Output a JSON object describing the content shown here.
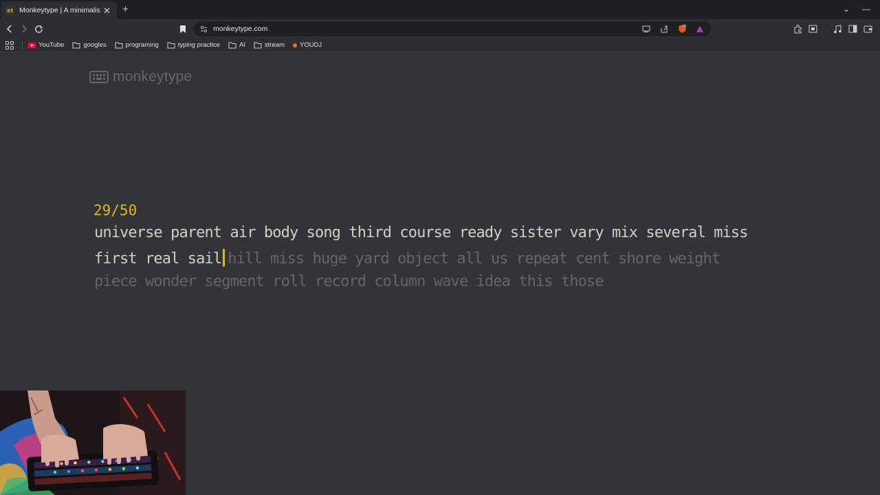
{
  "browser": {
    "tab": {
      "title": "Monkeytype | A minimalistic, customizable typing test",
      "favicon_text": "mt"
    },
    "url": "monkeytype.com",
    "bookmarks": [
      {
        "label": "YouTube",
        "icon": "youtube-icon"
      },
      {
        "label": "googles",
        "icon": "folder-icon"
      },
      {
        "label": "programing",
        "icon": "folder-icon"
      },
      {
        "label": "typing practice",
        "icon": "folder-icon"
      },
      {
        "label": "AI",
        "icon": "folder-icon"
      },
      {
        "label": "stream",
        "icon": "folder-icon"
      },
      {
        "label": "YOUDJ",
        "icon": "site-dot-icon"
      }
    ]
  },
  "app": {
    "logo_text": "monkeytype",
    "counter": "29/50",
    "lines": [
      {
        "typed": "universe parent air body song third course ready sister vary mix several miss",
        "untyped": ""
      },
      {
        "typed": "first real sail",
        "untyped": "hill miss huge yard object all us repeat cent shore weight"
      },
      {
        "typed": "",
        "untyped": "piece wonder segment roll record column wave idea this those"
      }
    ]
  },
  "colors": {
    "background": "#323437",
    "accent": "#e2b714",
    "typed_text": "#d1d0c5",
    "untyped_text": "#646669"
  }
}
